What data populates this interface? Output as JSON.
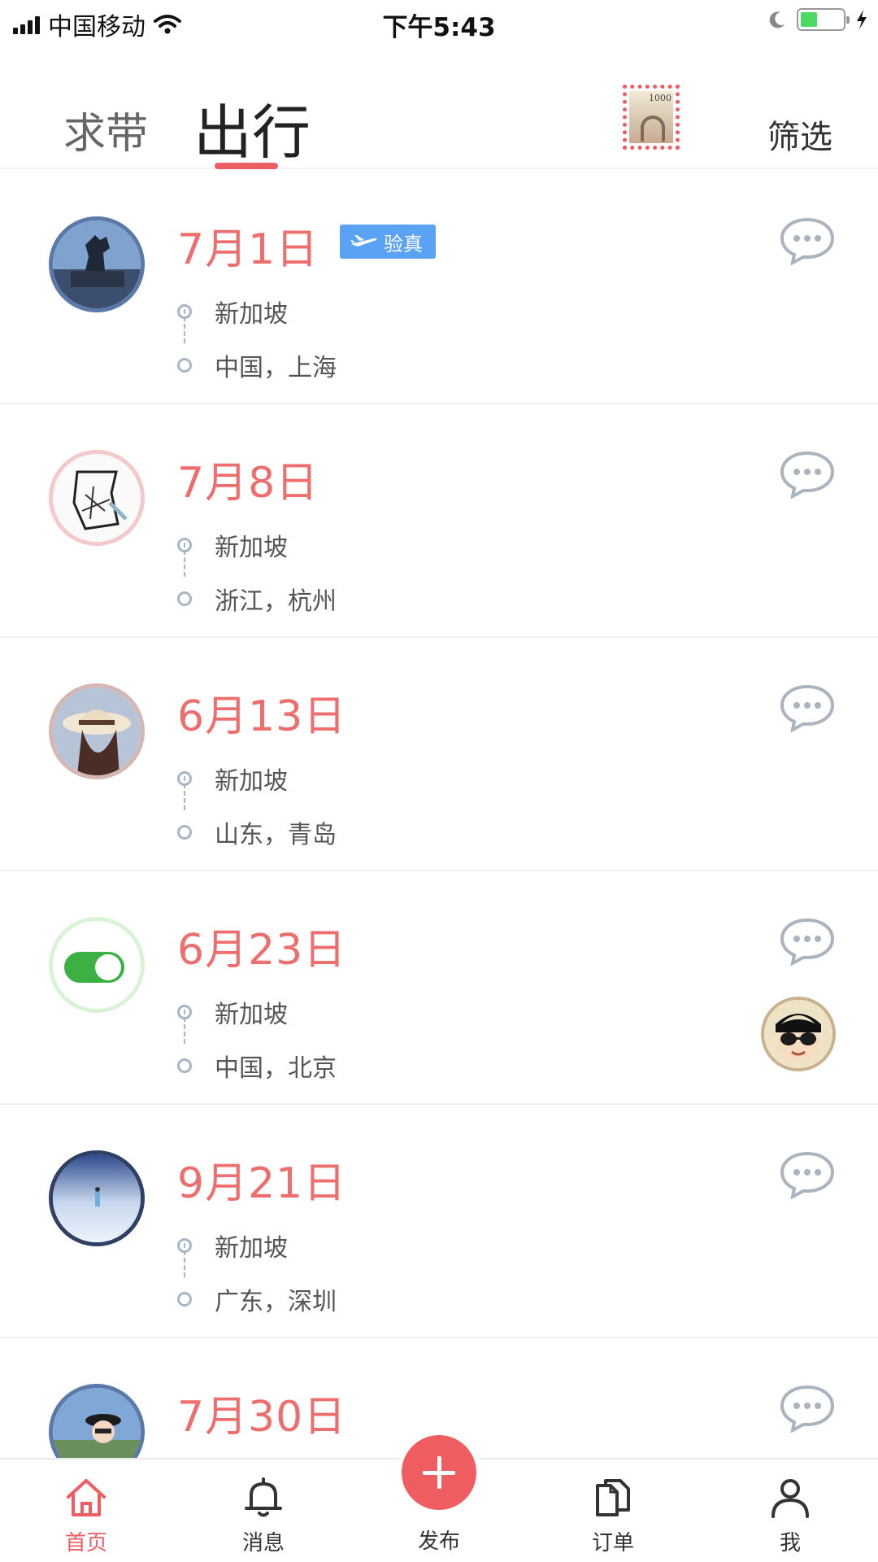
{
  "status_bar": {
    "carrier": "中国移动",
    "time": "下午5:43"
  },
  "header": {
    "tabs": [
      {
        "label": "求带",
        "active": false
      },
      {
        "label": "出行",
        "active": true
      }
    ],
    "stamp_value": "1000",
    "filter_label": "筛选",
    "accent_color": "#ee5d61"
  },
  "trips": [
    {
      "date": "7月1日",
      "badge": "验真",
      "from": "新加坡",
      "to": "中国，上海"
    },
    {
      "date": "7月8日",
      "from": "新加坡",
      "to": "浙江，杭州"
    },
    {
      "date": "6月13日",
      "from": "新加坡",
      "to": "山东，青岛"
    },
    {
      "date": "6月23日",
      "from": "新加坡",
      "to": "中国，北京"
    },
    {
      "date": "9月21日",
      "from": "新加坡",
      "to": "广东，深圳"
    },
    {
      "date": "7月30日"
    }
  ],
  "bottom_nav": {
    "items": [
      {
        "label": "首页",
        "icon": "home-icon",
        "active": true
      },
      {
        "label": "消息",
        "icon": "bell-icon"
      },
      {
        "label": "发布",
        "icon": "plus-icon"
      },
      {
        "label": "订单",
        "icon": "documents-icon"
      },
      {
        "label": "我",
        "icon": "person-icon"
      }
    ]
  }
}
